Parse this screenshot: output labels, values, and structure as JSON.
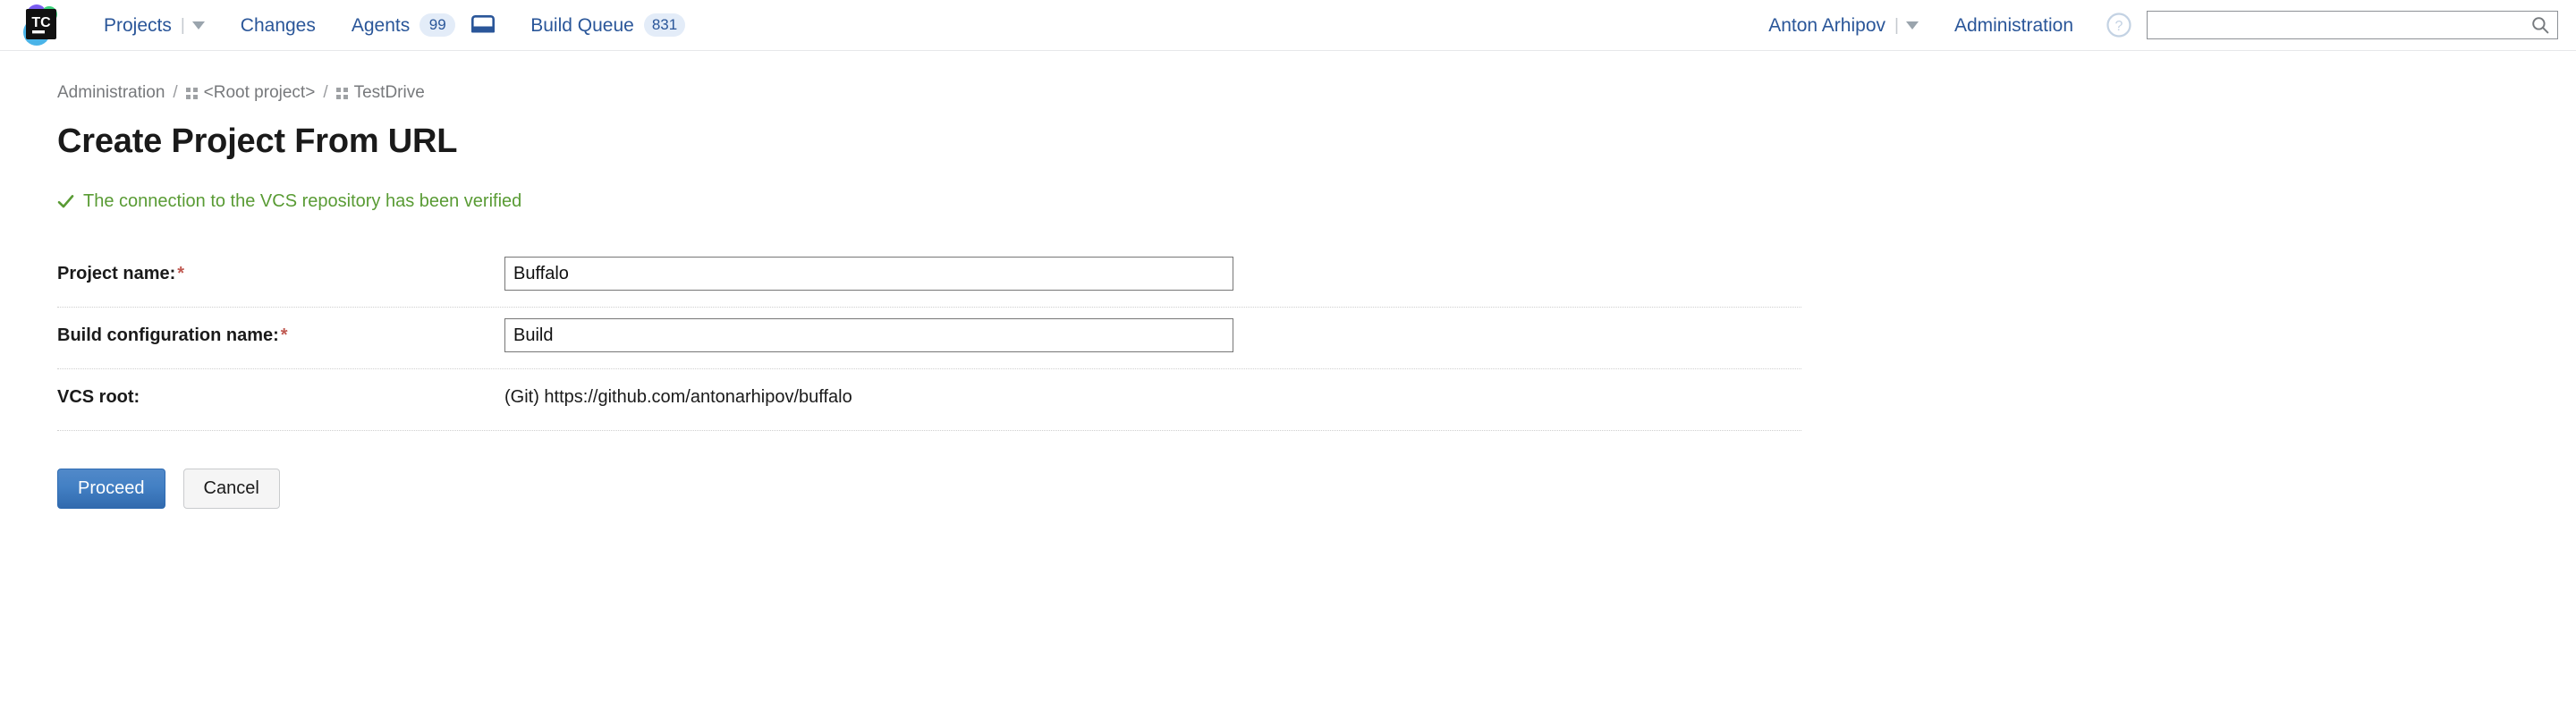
{
  "header": {
    "logo_alt": "teamcity-logo",
    "nav": [
      {
        "label": "Projects",
        "has_caret": true,
        "badge": null
      },
      {
        "label": "Changes",
        "has_caret": false,
        "badge": null
      },
      {
        "label": "Agents",
        "has_caret": false,
        "badge": "99"
      },
      {
        "label": "Build Queue",
        "has_caret": false,
        "badge": "831"
      }
    ],
    "user": {
      "name": "Anton Arhipov",
      "has_caret": true
    },
    "administration_label": "Administration",
    "help_label": "?",
    "search": {
      "value": "",
      "placeholder": ""
    }
  },
  "breadcrumb": [
    {
      "label": "Administration",
      "icon": false
    },
    {
      "label": "<Root project>",
      "icon": true
    },
    {
      "label": "TestDrive",
      "icon": true
    }
  ],
  "breadcrumb_separator": "/",
  "page": {
    "title": "Create Project From URL",
    "status_message": "The connection to the VCS repository has been verified",
    "status_icon": "check-icon",
    "status_color": "#599b34"
  },
  "form": {
    "rows": [
      {
        "label": "Project name:",
        "required": true,
        "type": "input",
        "value": "Buffalo"
      },
      {
        "label": "Build configuration name:",
        "required": true,
        "type": "input",
        "value": "Build"
      },
      {
        "label": "VCS root:",
        "required": false,
        "type": "static",
        "value": "(Git) https://github.com/antonarhipov/buffalo"
      }
    ],
    "required_marker": "*"
  },
  "actions": {
    "proceed_label": "Proceed",
    "cancel_label": "Cancel"
  },
  "colors": {
    "link": "#2a5699",
    "badge_bg": "#e3ecf8",
    "success": "#599b34",
    "required": "#c05a52",
    "primary_button": "#4380c4"
  }
}
